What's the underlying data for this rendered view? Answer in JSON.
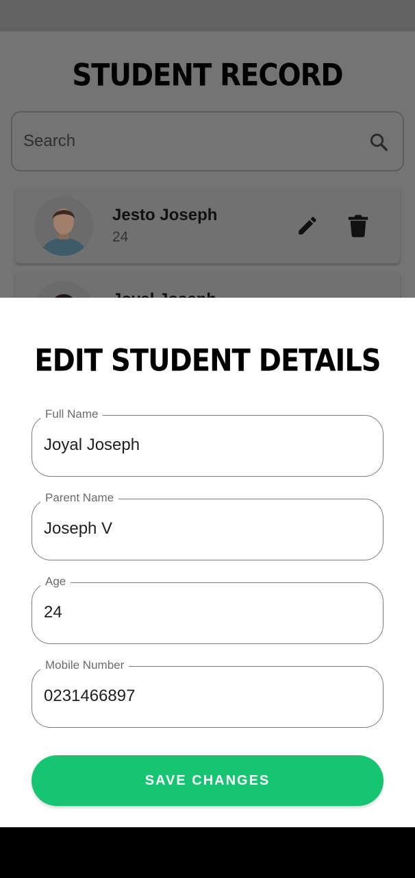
{
  "record_screen": {
    "title": "STUDENT RECORD",
    "search": {
      "placeholder": "Search",
      "icon": "search-icon"
    },
    "students": [
      {
        "name": "Jesto Joseph",
        "age": "24"
      },
      {
        "name": "Joyal Joseph",
        "age": ""
      }
    ]
  },
  "edit_sheet": {
    "title": "EDIT STUDENT DETAILS",
    "fields": [
      {
        "label": "Full Name",
        "value": "Joyal Joseph"
      },
      {
        "label": "Parent Name",
        "value": "Joseph V"
      },
      {
        "label": "Age",
        "value": "24"
      },
      {
        "label": "Mobile Number",
        "value": "0231466897"
      }
    ],
    "save_label": "SAVE CHANGES"
  },
  "colors": {
    "accent": "#15c571",
    "scrim": "#747474",
    "sheet_bg": "#ffffff"
  }
}
